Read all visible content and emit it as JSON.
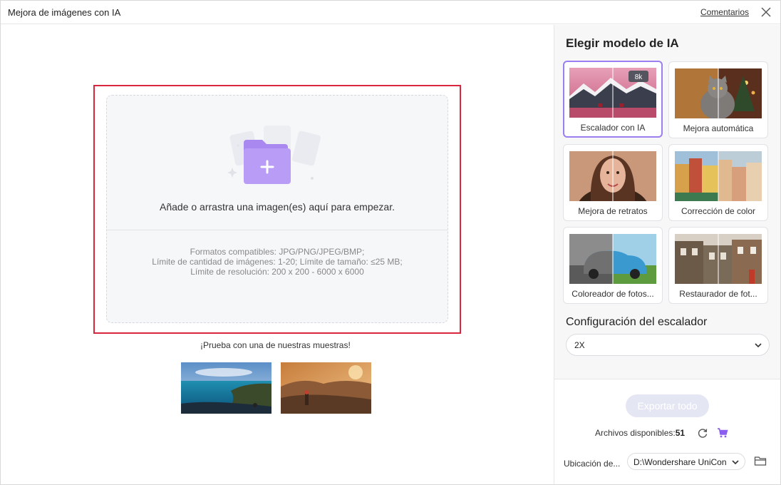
{
  "window": {
    "title": "Mejora de imágenes con IA",
    "feedback_label": "Comentarios"
  },
  "dropzone": {
    "main_text": "Añade o arrastra una imagen(es) aquí para empezar.",
    "formats": "Formatos compatibles: JPG/PNG/JPEG/BMP;",
    "limits": "Límite de cantidad de imágenes: 1-20; Límite de tamaño: ≤25 MB;",
    "resolution": "Límite de resolución: 200 x 200 - 6000 x 6000"
  },
  "samples": {
    "prompt": "¡Prueba con una de nuestras muestras!"
  },
  "panel": {
    "heading": "Elegir modelo de IA",
    "models": [
      {
        "label": "Escalador con IA",
        "selected": true,
        "badge": "8k"
      },
      {
        "label": "Mejora automática",
        "selected": false
      },
      {
        "label": "Mejora de retratos",
        "selected": false
      },
      {
        "label": "Corrección de color",
        "selected": false
      },
      {
        "label": "Coloreador de fotos...",
        "selected": false
      },
      {
        "label": "Restaurador de fot...",
        "selected": false
      }
    ],
    "config_title": "Configuración del escalador",
    "scale_value": "2X"
  },
  "footer": {
    "export_label": "Exportar todo",
    "files_label": "Archivos disponibles:",
    "files_count": "51",
    "location_label": "Ubicación de...",
    "location_value": "D:\\Wondershare UniCon"
  },
  "colors": {
    "accent": "#9b7ef0",
    "highlight_frame": "#d7263d",
    "export_disabled": "#e4e7f3"
  }
}
